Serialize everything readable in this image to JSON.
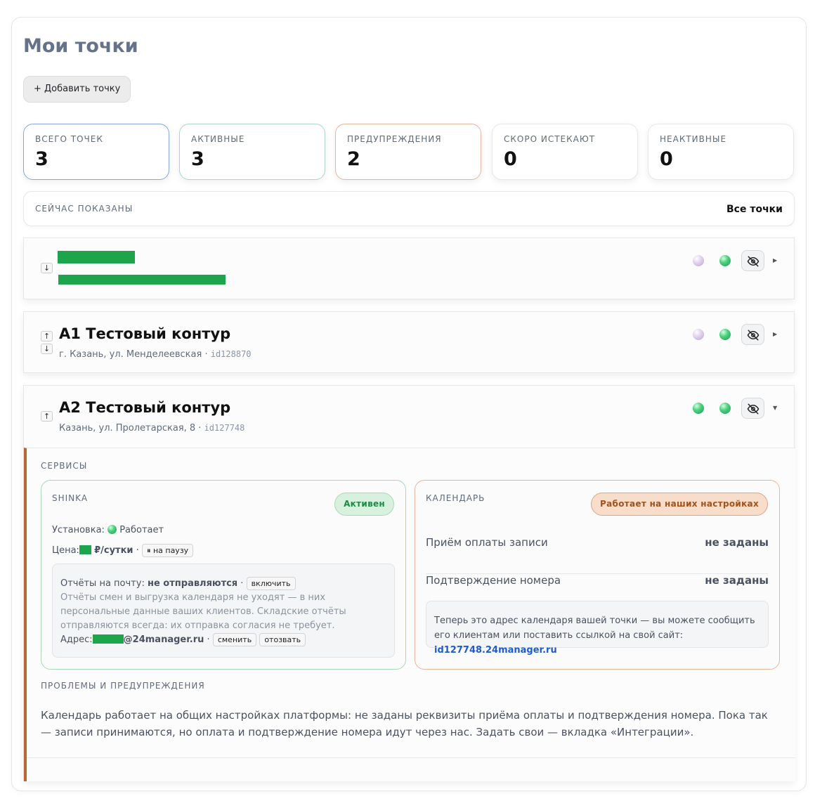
{
  "page": {
    "title": "Мои точки"
  },
  "toolbar": {
    "add_label": "+ Добавить точку"
  },
  "stats": [
    {
      "label": "ВСЕГО ТОЧЕК",
      "value": "3",
      "accent": "#8aa6dc"
    },
    {
      "label": "АКТИВНЫЕ",
      "value": "3",
      "accent": "#a9d8c4"
    },
    {
      "label": "ПРЕДУПРЕЖДЕНИЯ",
      "value": "2",
      "accent": "#e1b79e"
    },
    {
      "label": "СКОРО ИСТЕКАЮТ",
      "value": "0",
      "accent": "#e5e7eb"
    },
    {
      "label": "НЕАКТИВНЫЕ",
      "value": "0",
      "accent": "#e5e7eb"
    }
  ],
  "shown": {
    "label": "СЕЙЧАС ПОКАЗАНЫ",
    "value": "Все точки"
  },
  "points": [
    {
      "title": "",
      "subtitle": "",
      "id": "",
      "redacted": true,
      "arrows": [
        "↓"
      ],
      "status_icons": [
        "lilac-dot-icon",
        "green-dot-icon"
      ],
      "expanded": false
    },
    {
      "title": "А1 Тестовый контур",
      "subtitle": "г. Казань, ул. Менделеевская · ",
      "id": "id128870",
      "arrows": [
        "↑",
        "↓"
      ],
      "status_icons": [
        "lilac-dot-icon",
        "green-dot-icon"
      ],
      "expanded": false
    },
    {
      "title": "А2 Тестовый контур",
      "subtitle": "Казань, ул. Пролетарская, 8 · ",
      "id": "id127748",
      "arrows": [
        "↑"
      ],
      "status_icons": [
        "green-dot-icon",
        "green-dot-icon"
      ],
      "expanded": true
    }
  ],
  "details": {
    "services_label": "СЕРВИСЫ",
    "shinka": {
      "label": "SHINKA",
      "status": "Активен",
      "install_label": "Установка:",
      "install_value": "Работает",
      "price_label": "Цена:",
      "price_unit": "₽/сутки",
      "price_sep": "·",
      "pause_btn": "⏸ на паузу",
      "reports_label": "Отчёты на почту:",
      "reports_value": "не отправляются",
      "reports_sep": "·",
      "enable_btn": "включить",
      "reports_note": "Отчёты смен и выгрузка календаря не уходят — в них персональные данные ваших клиентов. Складские отчёты отправляются всегда: их отправка согласия не требует.",
      "address_label": "Адрес:",
      "address_domain": "@24manager.ru",
      "address_sep": "·",
      "change_btn": "сменить",
      "revoke_btn": "отозвать"
    },
    "calendar": {
      "label": "КАЛЕНДАРЬ",
      "status": "Работает на наших настройках",
      "rows": [
        {
          "label": "Приём оплаты записи",
          "value": "не заданы"
        },
        {
          "label": "Подтверждение номера",
          "value": "не заданы"
        }
      ],
      "note": "Теперь это адрес календаря вашей точки — вы можете сообщить его клиентам или поставить ссылкой на свой сайт: ",
      "link": "id127748.24manager.ru"
    },
    "problems_label": "ПРОБЛЕМЫ И ПРЕДУПРЕЖДЕНИЯ",
    "problems_text": "Календарь работает на общих настройках платформы: не заданы реквизиты приёма оплаты и подтверждения номера. Пока так — записи принимаются, но оплата и подтверждение номера идут через нас. Задать свои — вкладка «Интеграции»."
  },
  "colors": {
    "accent_green": "#1ea44a",
    "accent_brown": "#b76a30",
    "link_blue": "#1f5cc9",
    "title_gray": "#66728a"
  }
}
